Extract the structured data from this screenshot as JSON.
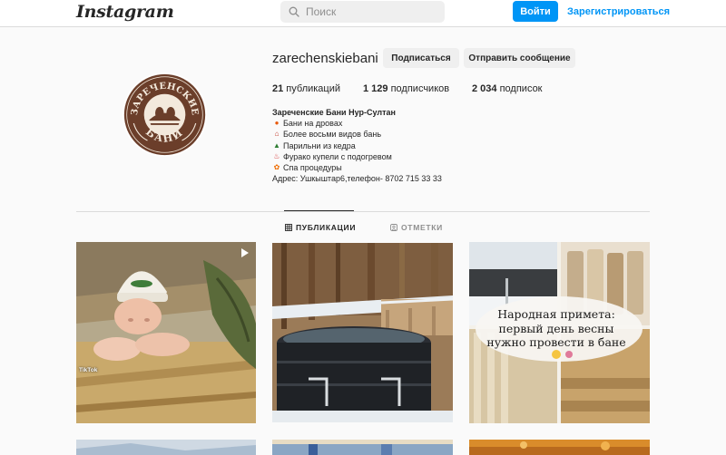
{
  "header": {
    "logo": "Instagram",
    "search_placeholder": "Поиск",
    "login_label": "Войти",
    "register_label": "Зарегистрироваться"
  },
  "profile": {
    "username": "zarechenskiebani",
    "follow_label": "Подписаться",
    "message_label": "Отправить сообщение",
    "avatar_text_top": "ЗАРЕЧЕНСКИЕ",
    "avatar_text_bottom": "БАНИ",
    "stats": {
      "posts_count": "21",
      "posts_label": " публикаций",
      "followers_count": "1 129",
      "followers_label": " подписчиков",
      "following_count": "2 034",
      "following_label": " подписок"
    },
    "bio": {
      "name": "Зареченские Бани Нур-Султан",
      "lines": [
        {
          "icon": "fire-icon",
          "emoji": "🔥",
          "text": "Бани на дровах"
        },
        {
          "icon": "house-icon",
          "emoji": "🏠",
          "text": "Более восьми видов бань"
        },
        {
          "icon": "tree-icon",
          "emoji": "🌲",
          "text": "Парильни из кедра"
        },
        {
          "icon": "hot-spring-icon",
          "emoji": "♨",
          "text": "Фурако купели с подогревом"
        },
        {
          "icon": "spa-flower-icon",
          "emoji": "✿",
          "text": "Спа процедуры"
        }
      ],
      "address": "Адрес: Ушкыштар6,телефон- 8702 715 33 33"
    }
  },
  "tabs": {
    "posts": "ПУБЛИКАЦИИ",
    "tagged": "ОТМЕТКИ"
  },
  "posts": {
    "p1_watermark": "TikTok",
    "p3_caption": [
      "Народная примета:",
      "первый день весны",
      "нужно провести в бане"
    ]
  },
  "colors": {
    "accent": "#0095f6",
    "border": "#dbdbdb",
    "background": "#fafafa",
    "avatar_brown": "#6b3e2a"
  }
}
